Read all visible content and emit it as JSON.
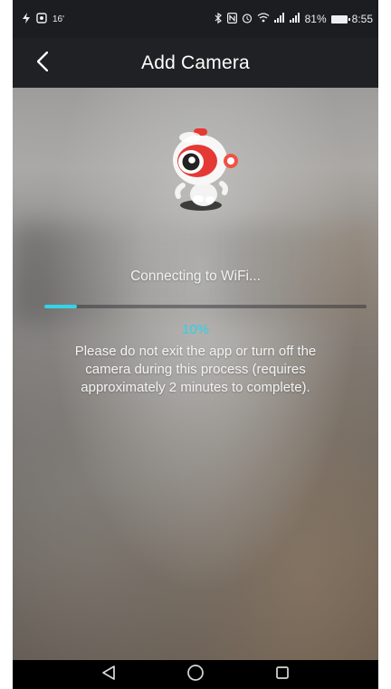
{
  "status_bar": {
    "left_icons": [
      "flash-icon",
      "notification-icon"
    ],
    "left_small": "16'",
    "battery": "81%",
    "time": "8:55",
    "right_icons": [
      "bluetooth-icon",
      "nfc-icon",
      "alarm-icon",
      "wifi-icon",
      "signal-icon",
      "signal-icon",
      "battery-icon"
    ]
  },
  "header": {
    "title": "Add Camera",
    "back_icon": "chevron-left-icon"
  },
  "content": {
    "connecting_text": "Connecting to WiFi...",
    "progress_percent_value": 10,
    "progress_percent_text": "10%",
    "notice": "Please do not exit the app or turn off the camera during this process (requires approximately 2 minutes to complete).",
    "mascot_icon": "robot-mascot-icon",
    "accent_color": "#34d3e8"
  },
  "nav_bar": {
    "back_icon": "back-triangle-icon",
    "home_icon": "home-circle-icon",
    "recent_icon": "recent-square-icon"
  }
}
